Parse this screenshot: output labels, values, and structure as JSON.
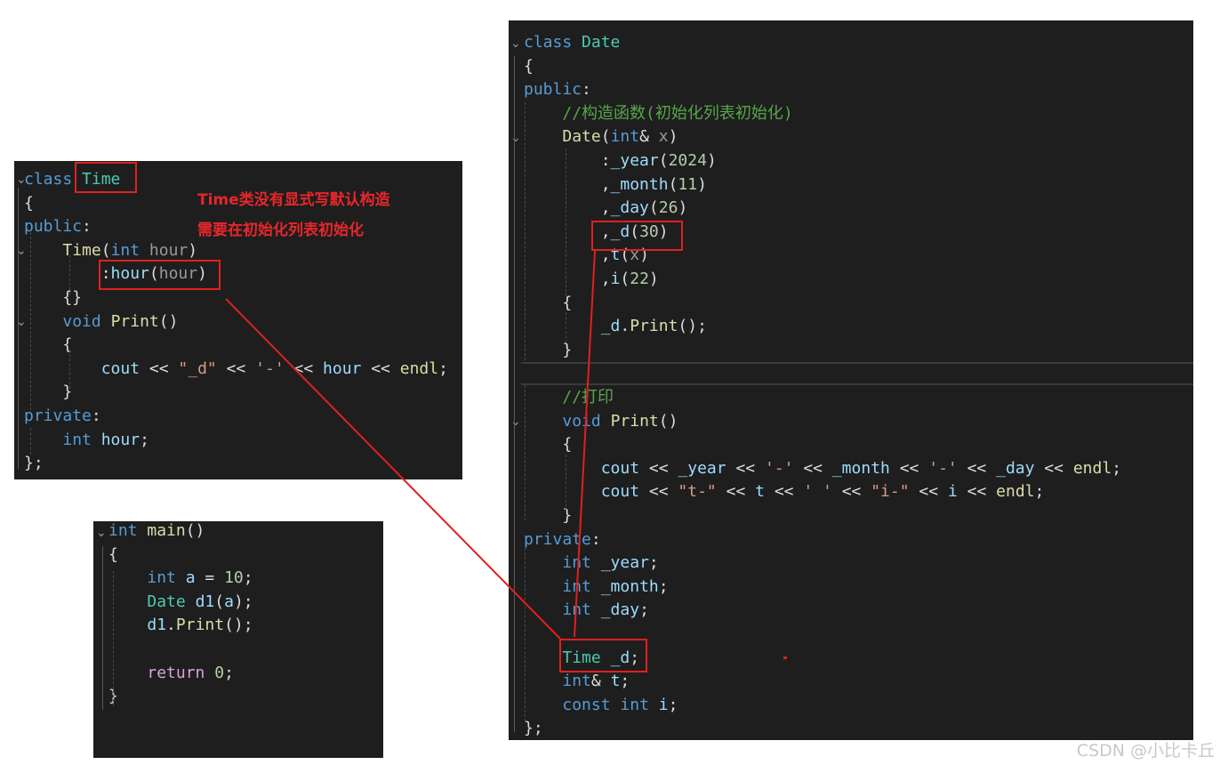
{
  "time_panel": {
    "lines": [
      {
        "tokens": [
          [
            "kw",
            "class"
          ],
          [
            "pl",
            " "
          ],
          [
            "ty",
            "Time"
          ]
        ]
      },
      {
        "tokens": [
          [
            "pl",
            "{"
          ]
        ]
      },
      {
        "tokens": [
          [
            "kw",
            "public"
          ],
          [
            "pl",
            ":"
          ]
        ]
      },
      {
        "tokens": [
          [
            "pl",
            "    "
          ],
          [
            "fn",
            "Time"
          ],
          [
            "pl",
            "("
          ],
          [
            "kw",
            "int"
          ],
          [
            "pl",
            " "
          ],
          [
            "gv",
            "hour"
          ],
          [
            "pl",
            ")"
          ]
        ]
      },
      {
        "tokens": [
          [
            "pl",
            "        :"
          ],
          [
            "pm",
            "hour"
          ],
          [
            "pl",
            "("
          ],
          [
            "gv",
            "hour"
          ],
          [
            "pl",
            ")"
          ]
        ]
      },
      {
        "tokens": [
          [
            "pl",
            "    {}"
          ]
        ]
      },
      {
        "tokens": [
          [
            "pl",
            "    "
          ],
          [
            "kw",
            "void"
          ],
          [
            "pl",
            " "
          ],
          [
            "fn",
            "Print"
          ],
          [
            "pl",
            "()"
          ]
        ]
      },
      {
        "tokens": [
          [
            "pl",
            "    {"
          ]
        ]
      },
      {
        "tokens": [
          [
            "pl",
            "        "
          ],
          [
            "pm",
            "cout"
          ],
          [
            "pl",
            " << "
          ],
          [
            "st",
            "\"_d\""
          ],
          [
            "pl",
            " << "
          ],
          [
            "st",
            "'-'"
          ],
          [
            "pl",
            " << "
          ],
          [
            "pm",
            "hour"
          ],
          [
            "pl",
            " << "
          ],
          [
            "fn",
            "endl"
          ],
          [
            "pl",
            ";"
          ]
        ]
      },
      {
        "tokens": [
          [
            "pl",
            "    }"
          ]
        ]
      },
      {
        "tokens": [
          [
            "kw",
            "private"
          ],
          [
            "pl",
            ":"
          ]
        ]
      },
      {
        "tokens": [
          [
            "pl",
            "    "
          ],
          [
            "kw",
            "int"
          ],
          [
            "pl",
            " "
          ],
          [
            "pm",
            "hour"
          ],
          [
            "pl",
            ";"
          ]
        ]
      },
      {
        "tokens": [
          [
            "pl",
            "};"
          ]
        ]
      }
    ],
    "annotation_line1": "Time类没有显式写默认构造",
    "annotation_line2": "需要在初始化列表初始化"
  },
  "main_panel": {
    "lines": [
      {
        "tokens": [
          [
            "kw",
            "int"
          ],
          [
            "pl",
            " "
          ],
          [
            "fn",
            "main"
          ],
          [
            "pl",
            "()"
          ]
        ]
      },
      {
        "tokens": [
          [
            "pl",
            "{"
          ]
        ]
      },
      {
        "tokens": [
          [
            "pl",
            "    "
          ],
          [
            "kw",
            "int"
          ],
          [
            "pl",
            " "
          ],
          [
            "pm",
            "a"
          ],
          [
            "pl",
            " = "
          ],
          [
            "nu",
            "10"
          ],
          [
            "pl",
            ";"
          ]
        ]
      },
      {
        "tokens": [
          [
            "pl",
            "    "
          ],
          [
            "ty",
            "Date"
          ],
          [
            "pl",
            " "
          ],
          [
            "pm",
            "d1"
          ],
          [
            "pl",
            "("
          ],
          [
            "pm",
            "a"
          ],
          [
            "pl",
            ");"
          ]
        ]
      },
      {
        "tokens": [
          [
            "pl",
            "    "
          ],
          [
            "pm",
            "d1"
          ],
          [
            "pl",
            "."
          ],
          [
            "fn",
            "Print"
          ],
          [
            "pl",
            "();"
          ]
        ]
      },
      {
        "tokens": [
          [
            "pl",
            ""
          ]
        ]
      },
      {
        "tokens": [
          [
            "pl",
            "    "
          ],
          [
            "ctl",
            "return"
          ],
          [
            "pl",
            " "
          ],
          [
            "nu",
            "0"
          ],
          [
            "pl",
            ";"
          ]
        ]
      },
      {
        "tokens": [
          [
            "pl",
            "}"
          ]
        ]
      }
    ]
  },
  "date_panel": {
    "lines": [
      {
        "tokens": [
          [
            "kw",
            "class"
          ],
          [
            "pl",
            " "
          ],
          [
            "ty",
            "Date"
          ]
        ]
      },
      {
        "tokens": [
          [
            "pl",
            "{"
          ]
        ]
      },
      {
        "tokens": [
          [
            "kw",
            "public"
          ],
          [
            "pl",
            ":"
          ]
        ]
      },
      {
        "tokens": [
          [
            "pl",
            "    "
          ],
          [
            "cm",
            "//构造函数(初始化列表初始化)"
          ]
        ]
      },
      {
        "tokens": [
          [
            "pl",
            "    "
          ],
          [
            "fn",
            "Date"
          ],
          [
            "pl",
            "("
          ],
          [
            "kw",
            "int"
          ],
          [
            "pl",
            "& "
          ],
          [
            "gv",
            "x"
          ],
          [
            "pl",
            ")"
          ]
        ]
      },
      {
        "tokens": [
          [
            "pl",
            "        :"
          ],
          [
            "pm",
            "_year"
          ],
          [
            "pl",
            "("
          ],
          [
            "nu",
            "2024"
          ],
          [
            "pl",
            ")"
          ]
        ]
      },
      {
        "tokens": [
          [
            "pl",
            "        ,"
          ],
          [
            "pm",
            "_month"
          ],
          [
            "pl",
            "("
          ],
          [
            "nu",
            "11"
          ],
          [
            "pl",
            ")"
          ]
        ]
      },
      {
        "tokens": [
          [
            "pl",
            "        ,"
          ],
          [
            "pm",
            "_day"
          ],
          [
            "pl",
            "("
          ],
          [
            "nu",
            "26"
          ],
          [
            "pl",
            ")"
          ]
        ]
      },
      {
        "tokens": [
          [
            "pl",
            "        ,"
          ],
          [
            "pm",
            "_d"
          ],
          [
            "pl",
            "("
          ],
          [
            "nu",
            "30"
          ],
          [
            "pl",
            ")"
          ]
        ]
      },
      {
        "tokens": [
          [
            "pl",
            "        ,"
          ],
          [
            "pm",
            "t"
          ],
          [
            "pl",
            "("
          ],
          [
            "gv",
            "x"
          ],
          [
            "pl",
            ")"
          ]
        ]
      },
      {
        "tokens": [
          [
            "pl",
            "        ,"
          ],
          [
            "pm",
            "i"
          ],
          [
            "pl",
            "("
          ],
          [
            "nu",
            "22"
          ],
          [
            "pl",
            ")"
          ]
        ]
      },
      {
        "tokens": [
          [
            "pl",
            "    {"
          ]
        ]
      },
      {
        "tokens": [
          [
            "pl",
            "        "
          ],
          [
            "pm",
            "_d"
          ],
          [
            "pl",
            "."
          ],
          [
            "fn",
            "Print"
          ],
          [
            "pl",
            "();"
          ]
        ]
      },
      {
        "tokens": [
          [
            "pl",
            "    }"
          ]
        ]
      },
      {
        "tokens": [
          [
            "pl",
            ""
          ]
        ]
      },
      {
        "tokens": [
          [
            "pl",
            "    "
          ],
          [
            "cm",
            "//打印"
          ]
        ]
      },
      {
        "tokens": [
          [
            "pl",
            "    "
          ],
          [
            "kw",
            "void"
          ],
          [
            "pl",
            " "
          ],
          [
            "fn",
            "Print"
          ],
          [
            "pl",
            "()"
          ]
        ]
      },
      {
        "tokens": [
          [
            "pl",
            "    {"
          ]
        ]
      },
      {
        "tokens": [
          [
            "pl",
            "        "
          ],
          [
            "pm",
            "cout"
          ],
          [
            "pl",
            " << "
          ],
          [
            "pm",
            "_year"
          ],
          [
            "pl",
            " << "
          ],
          [
            "st",
            "'-'"
          ],
          [
            "pl",
            " << "
          ],
          [
            "pm",
            "_month"
          ],
          [
            "pl",
            " << "
          ],
          [
            "st",
            "'-'"
          ],
          [
            "pl",
            " << "
          ],
          [
            "pm",
            "_day"
          ],
          [
            "pl",
            " << "
          ],
          [
            "fn",
            "endl"
          ],
          [
            "pl",
            ";"
          ]
        ]
      },
      {
        "tokens": [
          [
            "pl",
            "        "
          ],
          [
            "pm",
            "cout"
          ],
          [
            "pl",
            " << "
          ],
          [
            "st",
            "\"t-\""
          ],
          [
            "pl",
            " << "
          ],
          [
            "pm",
            "t"
          ],
          [
            "pl",
            " << "
          ],
          [
            "st",
            "' '"
          ],
          [
            "pl",
            " << "
          ],
          [
            "st",
            "\"i-\""
          ],
          [
            "pl",
            " << "
          ],
          [
            "pm",
            "i"
          ],
          [
            "pl",
            " << "
          ],
          [
            "fn",
            "endl"
          ],
          [
            "pl",
            ";"
          ]
        ]
      },
      {
        "tokens": [
          [
            "pl",
            "    }"
          ]
        ]
      },
      {
        "tokens": [
          [
            "kw",
            "private"
          ],
          [
            "pl",
            ":"
          ]
        ]
      },
      {
        "tokens": [
          [
            "pl",
            "    "
          ],
          [
            "kw",
            "int"
          ],
          [
            "pl",
            " "
          ],
          [
            "pm",
            "_year"
          ],
          [
            "pl",
            ";"
          ]
        ]
      },
      {
        "tokens": [
          [
            "pl",
            "    "
          ],
          [
            "kw",
            "int"
          ],
          [
            "pl",
            " "
          ],
          [
            "pm",
            "_month"
          ],
          [
            "pl",
            ";"
          ]
        ]
      },
      {
        "tokens": [
          [
            "pl",
            "    "
          ],
          [
            "kw",
            "int"
          ],
          [
            "pl",
            " "
          ],
          [
            "pm",
            "_day"
          ],
          [
            "pl",
            ";"
          ]
        ]
      },
      {
        "tokens": [
          [
            "pl",
            ""
          ]
        ]
      },
      {
        "tokens": [
          [
            "pl",
            "    "
          ],
          [
            "ty",
            "Time"
          ],
          [
            "pl",
            " "
          ],
          [
            "pm",
            "_d"
          ],
          [
            "pl",
            ";"
          ]
        ]
      },
      {
        "tokens": [
          [
            "pl",
            "    "
          ],
          [
            "kw",
            "int"
          ],
          [
            "pl",
            "& "
          ],
          [
            "pm",
            "t"
          ],
          [
            "pl",
            ";"
          ]
        ]
      },
      {
        "tokens": [
          [
            "pl",
            "    "
          ],
          [
            "kw",
            "const"
          ],
          [
            "pl",
            " "
          ],
          [
            "kw",
            "int"
          ],
          [
            "pl",
            " "
          ],
          [
            "pm",
            "i"
          ],
          [
            "pl",
            ";"
          ]
        ]
      },
      {
        "tokens": [
          [
            "pl",
            "};"
          ]
        ]
      }
    ]
  },
  "watermark": "CSDN @小比卡丘",
  "colors": {
    "background": "#ffffff",
    "editor_bg": "#1e1e1e",
    "annotation_red": "#e8262b",
    "keyword": "#569cd6",
    "type": "#4ec9b0",
    "function": "#dcdcaa",
    "variable": "#9cdcfe",
    "number": "#b5cea8",
    "string": "#d69d85",
    "comment": "#57a64a",
    "control": "#d8a0df"
  }
}
